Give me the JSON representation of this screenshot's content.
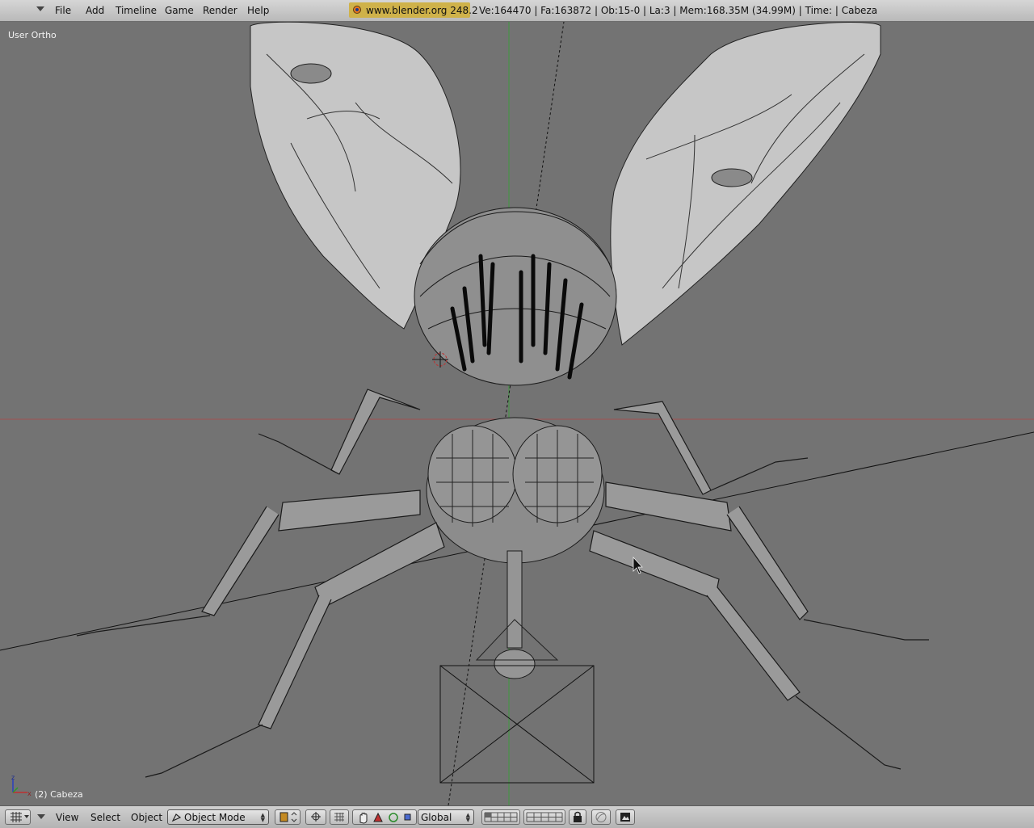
{
  "topbar": {
    "menus": [
      "File",
      "Add",
      "Timeline",
      "Game",
      "Render",
      "Help"
    ],
    "brand": "www.blender.org 248.2",
    "stats": "Ve:164470 | Fa:163872 | Ob:15-0 | La:3  | Mem:168.35M (34.99M)  | Time: | Cabeza"
  },
  "viewport": {
    "view_label": "User Ortho",
    "object_label": "(2) Cabeza",
    "axis_z": "z",
    "axis_x": "x"
  },
  "bottombar": {
    "view": "View",
    "select": "Select",
    "object": "Object",
    "mode": "Object Mode",
    "orientation": "Global"
  },
  "icons": [
    "menu-triangle-icon",
    "blender-logo-icon",
    "viewport-grid-icon",
    "object-mode-icon",
    "pivot-icon",
    "snap-icon",
    "hand-icon",
    "translate-icon",
    "rotate-icon",
    "scale-icon",
    "layer-grid-icon",
    "lock-icon",
    "onion-icon",
    "render-icon",
    "axis-icon"
  ],
  "colors": {
    "viewport_bg": "#737373",
    "header_bg": "#c4c4c4",
    "brand_bg": "#cfb24a",
    "x_axis_line": "#a05050",
    "y_axis_line": "#3f9a3f"
  }
}
